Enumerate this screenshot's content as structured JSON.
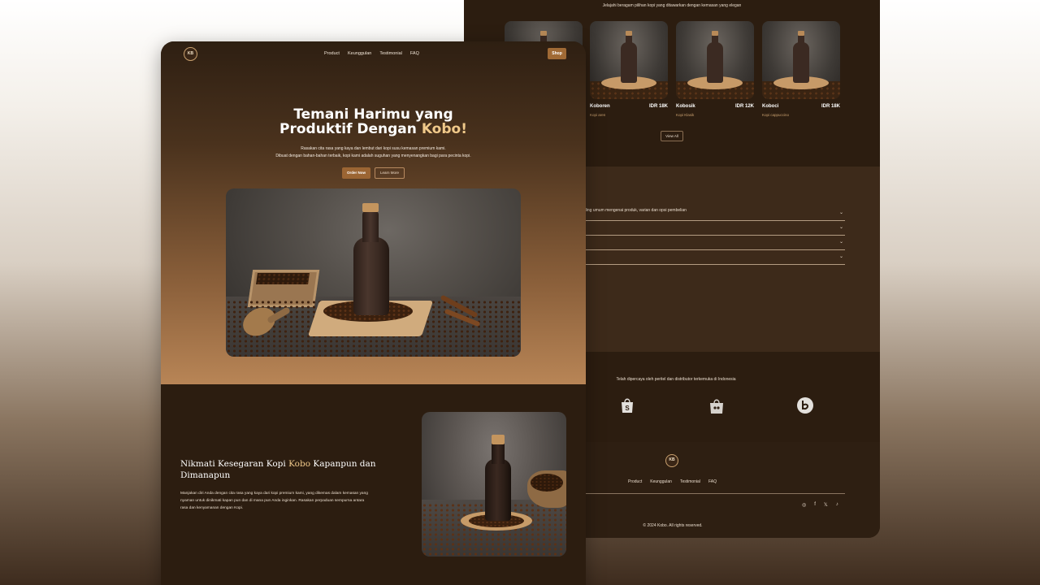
{
  "back_page": {
    "products_subtitle": "Jelajahi beragam pilihan kopi yang ditawarkan dengan kemasan yang elegan",
    "products": [
      {
        "name": "",
        "price": "",
        "variant": ""
      },
      {
        "name": "Koboren",
        "price": "IDR 18K",
        "variant": "Kopi aren"
      },
      {
        "name": "Kobosik",
        "price": "IDR 12K",
        "variant": "Kopi Klasik"
      },
      {
        "name": "Koboci",
        "price": "IDR 18K",
        "variant": "Kopi cappuccino"
      }
    ],
    "view_all_label": "View All",
    "faq_subtitle": "ding umum mengenai produk, varian dan opsi pembelian",
    "faq_rows": [
      "",
      "",
      "",
      ""
    ],
    "faq_chevron": "⌄",
    "partners_subtitle": "Telah dipercaya oleh peritel dan distributor terkemuka di Indonesia",
    "partners": [
      "shopee-icon",
      "tokopedia-icon",
      "bukalapak-icon"
    ],
    "footer": {
      "logo_text": "KB",
      "nav": [
        "Product",
        "Keunggulan",
        "Testimonial",
        "FAQ"
      ],
      "social": [
        "instagram-icon",
        "facebook-icon",
        "x-icon",
        "tiktok-icon"
      ],
      "social_glyphs": [
        "◎",
        "f",
        "𝕏",
        "♪"
      ],
      "copyright": "© 2024 Kobo. All rights reserved."
    }
  },
  "front_page": {
    "logo_text": "KB",
    "nav": [
      "Product",
      "Keunggulan",
      "Testimonial",
      "FAQ"
    ],
    "shop_label": "Shop",
    "hero": {
      "title_line1": "Temani Harimu yang",
      "title_line2_prefix": "Produktif Dengan ",
      "title_accent": "Kobo!",
      "desc_line1": "Rasakan cita rasa yang kaya dan lembut dari kopi susu kemasan premium kami.",
      "desc_line2": "Dibuat dengan bahan-bahan terbaik, kopi kami adalah suguhan yang menyenangkan bagi para pecinta kopi.",
      "order_label": "Order Now",
      "learn_label": "Learn More"
    },
    "about": {
      "title_prefix": "Nikmati Kesegaran Kopi ",
      "title_accent": "Kobo",
      "title_suffix": " Kapanpun dan Dimanapun",
      "desc": "Manjakan diri Anda dengan cita rasa yang kaya dari kopi premium kami, yang dikemas dalam kemasan yang nyaman untuk dinikmati kapan pun dan di mana pun Anda inginkan. Rasakan perpaduan sempurna antara rasa dan kenyamanan dengan Kopi."
    }
  },
  "colors": {
    "accent": "#f0c98a",
    "brown_dark": "#2c1d10",
    "button": "#a06a35"
  }
}
